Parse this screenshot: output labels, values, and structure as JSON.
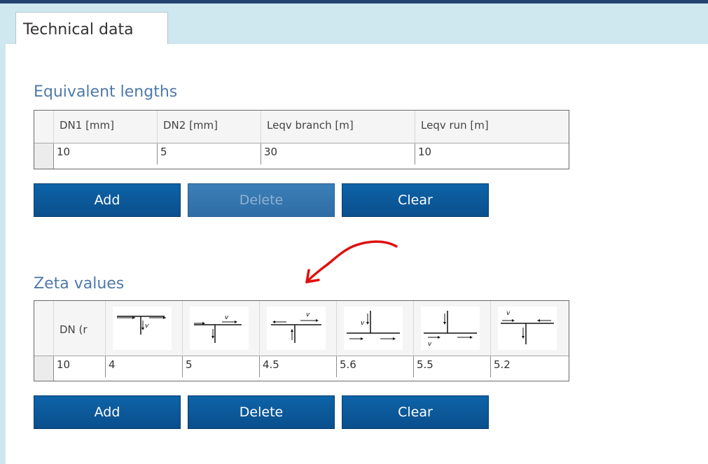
{
  "tab": {
    "label": "Technical data"
  },
  "equivalent": {
    "title": "Equivalent lengths",
    "columns": [
      "DN1 [mm]",
      "DN2 [mm]",
      "Leqv branch [m]",
      "Leqv run [m]"
    ],
    "row": [
      "10",
      "5",
      "30",
      "10"
    ],
    "buttons": {
      "add": "Add",
      "delete": "Delete",
      "clear": "Clear"
    }
  },
  "zeta": {
    "title": "Zeta values",
    "first_column": "DN (r",
    "icon_columns": [
      "tee-diverging-branch-down-icon",
      "tee-diverging-run-right-icon",
      "tee-converging-branch-up-icon",
      "tee-converging-branch-down-icon",
      "tee-diverging-branch-up-icon",
      "tee-converging-run-icon"
    ],
    "row": [
      "10",
      "4",
      "5",
      "4.5",
      "5.6",
      "5.5",
      "5.2"
    ],
    "buttons": {
      "add": "Add",
      "delete": "Delete",
      "clear": "Clear"
    }
  },
  "colors": {
    "accent": "#0a5899",
    "title": "#4f79a8",
    "tabstrip": "#cfe8f0",
    "annotation": "#e01010"
  }
}
